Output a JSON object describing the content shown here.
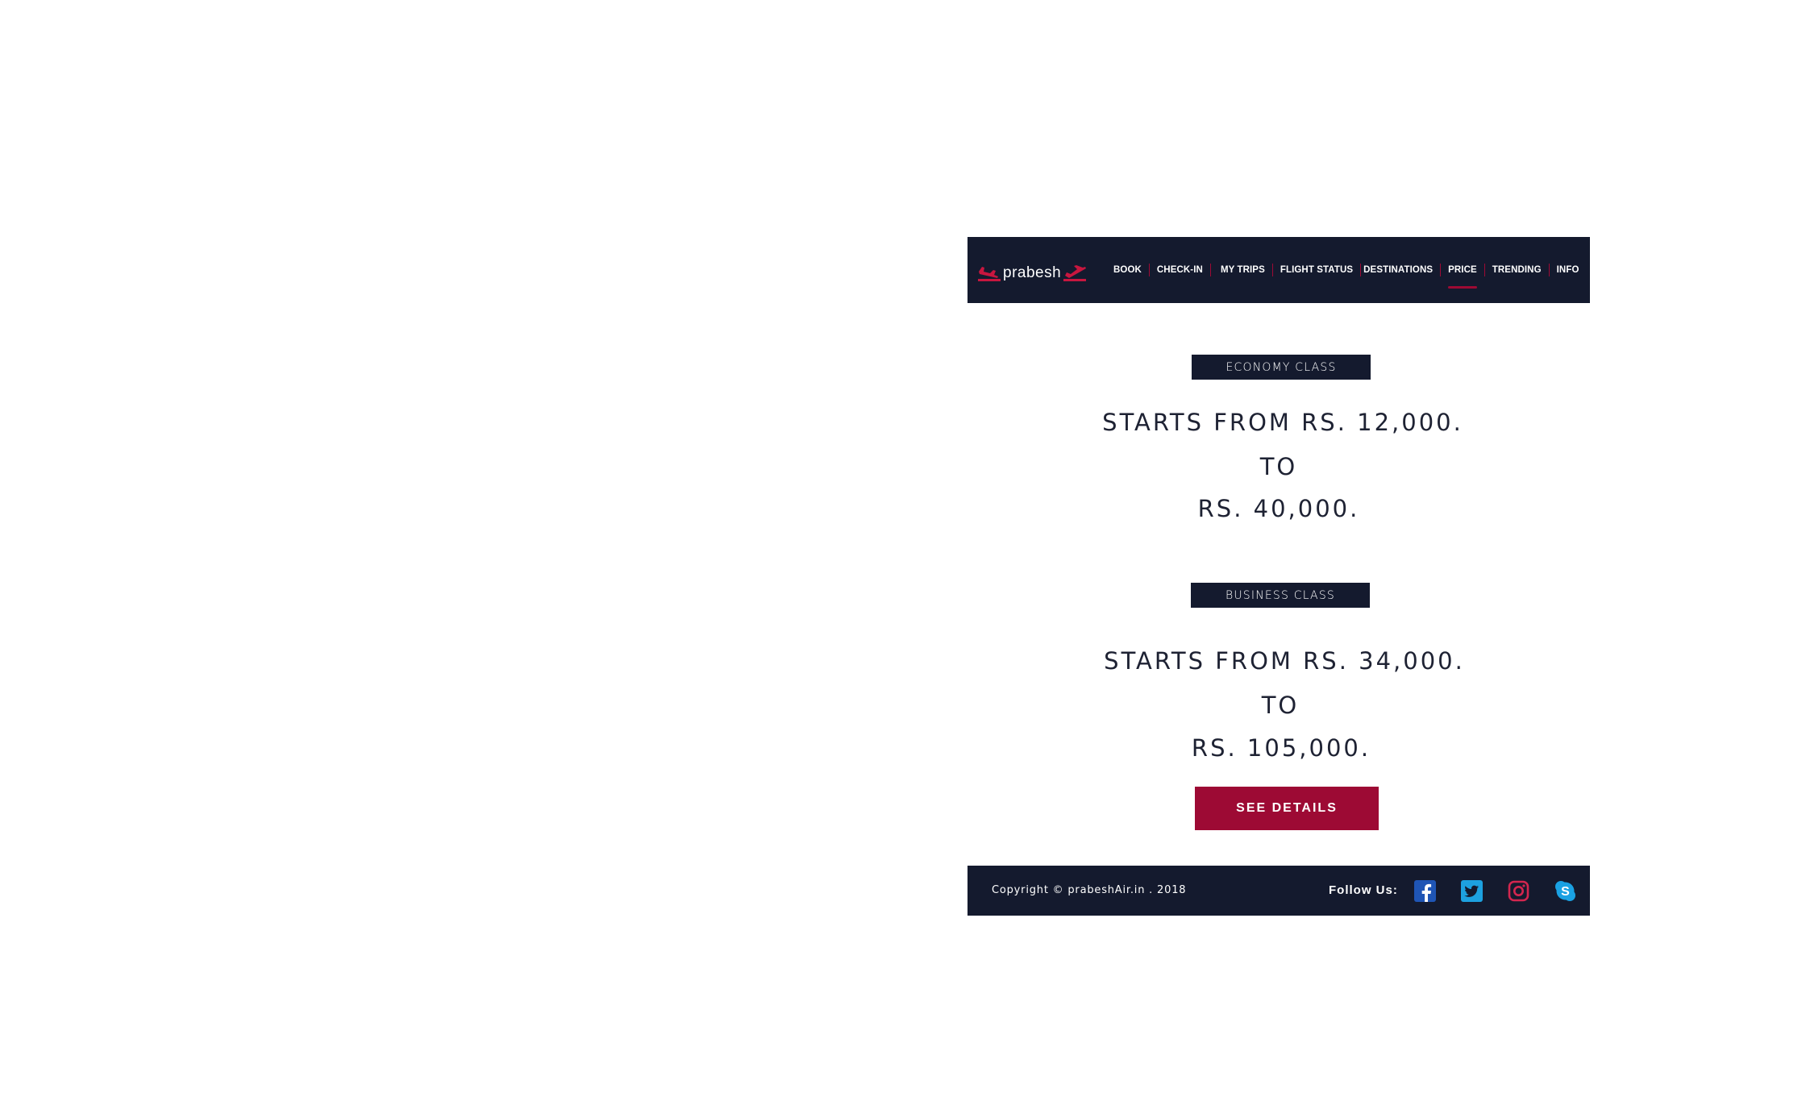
{
  "header": {
    "logo_text": "prabesh",
    "nav": [
      {
        "label": "BOOK"
      },
      {
        "label": "CHECK-IN"
      },
      {
        "label": "MY TRIPS"
      },
      {
        "label": "FLIGHT STATUS"
      },
      {
        "label": "DESTINATIONS"
      },
      {
        "label": "PRICE",
        "active": true
      },
      {
        "label": "TRENDING"
      },
      {
        "label": "INFO"
      }
    ]
  },
  "economy": {
    "badge": "ECONOMY CLASS",
    "line1": "STARTS FROM RS. 12,000.",
    "line2": "TO",
    "line3": "RS. 40,000."
  },
  "business": {
    "badge": "BUSINESS CLASS",
    "line1": "STARTS FROM RS. 34,000.",
    "line2": "TO",
    "line3": "RS. 105,000."
  },
  "cta": {
    "label": "SEE DETAILS"
  },
  "footer": {
    "copyright": "Copyright © prabeshAir.in . 2018",
    "follow_label": "Follow Us:",
    "social": [
      "facebook-icon",
      "twitter-icon",
      "instagram-icon",
      "skype-icon"
    ]
  },
  "colors": {
    "navy": "#141a2e",
    "accent": "#9d0a34",
    "text": "#1e2233"
  }
}
